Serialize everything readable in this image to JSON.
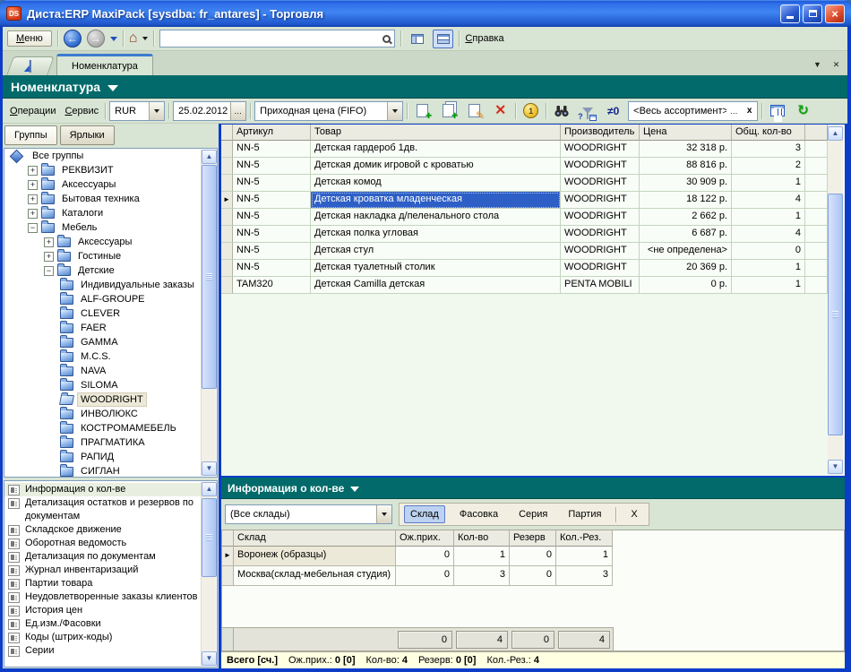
{
  "window": {
    "title": "Диста:ERP MaxiPack [sysdba: fr_antares] - Торговля",
    "logo": "DS"
  },
  "menubar": {
    "menu": "Меню",
    "help": "Справка",
    "search_value": ""
  },
  "tabbar": {
    "active_tab": "Номенклатура"
  },
  "page": {
    "title": "Номенклатура"
  },
  "toolbar": {
    "menu_operations": "Операции",
    "menu_service": "Сервис",
    "currency": "RUR",
    "date": "25.02.2012",
    "price_type": "Приходная цена (FIFO)",
    "assortment": "<Весь ассортимент>",
    "neq_zero": "≠0"
  },
  "left": {
    "tab_groups": "Группы",
    "tab_labels": "Ярлыки",
    "tree": [
      {
        "label": "Все группы"
      },
      {
        "label": "РЕКВИЗИТ"
      },
      {
        "label": "Аксессуары"
      },
      {
        "label": "Бытовая техника"
      },
      {
        "label": "Каталоги"
      },
      {
        "label": "Мебель"
      },
      {
        "label": "Аксессуары"
      },
      {
        "label": "Гостиные"
      },
      {
        "label": "Детские"
      },
      {
        "label": "Индивидуальные заказы"
      },
      {
        "label": "ALF-GROUPE"
      },
      {
        "label": "CLEVER"
      },
      {
        "label": "FAER"
      },
      {
        "label": "GAMMA"
      },
      {
        "label": "M.C.S."
      },
      {
        "label": "NAVA"
      },
      {
        "label": "SILOMA"
      },
      {
        "label": "WOODRIGHT"
      },
      {
        "label": "ИНВОЛЮКС"
      },
      {
        "label": "КОСТРОМАМЕБЕЛЬ"
      },
      {
        "label": "ПРАГМАТИКА"
      },
      {
        "label": "РАПИД"
      },
      {
        "label": "СИГЛАН"
      }
    ],
    "list": [
      {
        "label": "Информация о кол-ве"
      },
      {
        "label": "Детализация остатков и резервов по документам"
      },
      {
        "label": "Складское движение"
      },
      {
        "label": "Оборотная ведомость"
      },
      {
        "label": "Детализация по документам"
      },
      {
        "label": "Журнал инвентаризаций"
      },
      {
        "label": "Партии товара"
      },
      {
        "label": "Неудовлетворенные заказы клиентов"
      },
      {
        "label": "История цен"
      },
      {
        "label": "Ед.изм./Фасовки"
      },
      {
        "label": "Коды (штрих-коды)"
      },
      {
        "label": "Серии"
      }
    ]
  },
  "grid": {
    "columns": {
      "article": "Артикул",
      "product": "Товар",
      "maker": "Производитель",
      "price": "Цена",
      "qty": "Общ. кол-во"
    },
    "rows": [
      {
        "article": "NN-5",
        "product": "Детская гардероб 1дв.",
        "maker": "WOODRIGHT",
        "price": "32 318 р.",
        "qty": "3"
      },
      {
        "article": "NN-5",
        "product": "Детская домик игровой с кроватью",
        "maker": "WOODRIGHT",
        "price": "88 816 р.",
        "qty": "2"
      },
      {
        "article": "NN-5",
        "product": "Детская комод",
        "maker": "WOODRIGHT",
        "price": "30 909 р.",
        "qty": "1"
      },
      {
        "article": "NN-5",
        "product": "Детская кроватка младенческая",
        "maker": "WOODRIGHT",
        "price": "18 122 р.",
        "qty": "4"
      },
      {
        "article": "NN-5",
        "product": "Детская накладка д/пеленального стола",
        "maker": "WOODRIGHT",
        "price": "2 662 р.",
        "qty": "1"
      },
      {
        "article": "NN-5",
        "product": "Детская полка угловая",
        "maker": "WOODRIGHT",
        "price": "6 687 р.",
        "qty": "4"
      },
      {
        "article": "NN-5",
        "product": "Детская стул",
        "maker": "WOODRIGHT",
        "price": "<не определена>",
        "qty": "0"
      },
      {
        "article": "NN-5",
        "product": "Детская туалетный столик",
        "maker": "WOODRIGHT",
        "price": "20 369 р.",
        "qty": "1"
      },
      {
        "article": "TAM320",
        "product": "Детская Camilla детская",
        "maker": "PENTA MOBILI",
        "price": "0 р.",
        "qty": "1"
      }
    ]
  },
  "bottom": {
    "title": "Информация о кол-ве",
    "warehouse_filter": "(Все склады)",
    "tabs": [
      "Склад",
      "Фасовка",
      "Серия",
      "Партия",
      "X"
    ],
    "grid": {
      "columns": {
        "name": "Склад",
        "expected": "Ож.прих.",
        "qty": "Кол-во",
        "reserve": "Резерв",
        "qtyres": "Кол.-Рез."
      },
      "rows": [
        {
          "name": "Воронеж (образцы)",
          "expected": "0",
          "qty": "1",
          "reserve": "0",
          "qtyres": "1"
        },
        {
          "name": "Москва(склад-мебельная студия)",
          "expected": "0",
          "qty": "3",
          "reserve": "0",
          "qtyres": "3"
        }
      ],
      "totals": {
        "expected": "0",
        "qty": "4",
        "reserve": "0",
        "qtyres": "4"
      }
    },
    "status": {
      "total": "Всего [сч.]",
      "s1l": "Ож.прих.:",
      "s1v": "0 [0]",
      "s2l": "Кол-во:",
      "s2v": "4",
      "s3l": "Резерв:",
      "s3v": "0 [0]",
      "s4l": "Кол.-Рез.:",
      "s4v": "4"
    }
  }
}
